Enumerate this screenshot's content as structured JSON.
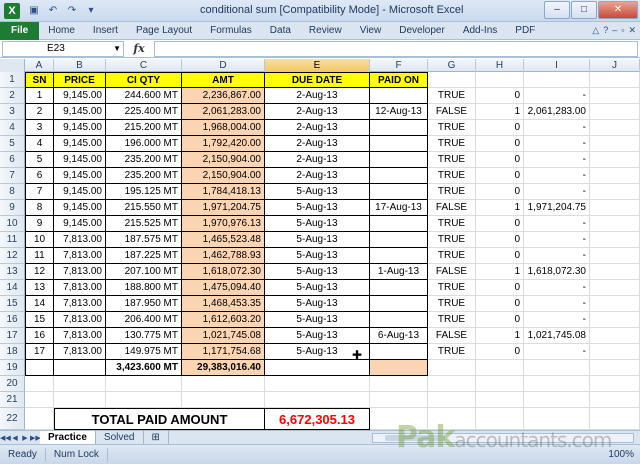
{
  "window": {
    "title": "conditional sum  [Compatibility Mode]  -  Microsoft Excel",
    "app_icon": "X",
    "controls": [
      "–",
      "□",
      "✕"
    ]
  },
  "ribbon": {
    "tabs": [
      "File",
      "Home",
      "Insert",
      "Page Layout",
      "Formulas",
      "Data",
      "Review",
      "View",
      "Developer",
      "Add-Ins",
      "PDF"
    ]
  },
  "formula_bar": {
    "name_box": "E23",
    "fx": "fx",
    "value": ""
  },
  "columns": [
    "A",
    "B",
    "C",
    "D",
    "E",
    "F",
    "G",
    "H",
    "I",
    "J"
  ],
  "header": {
    "row": "1",
    "sn": "SN",
    "price": "PRICE",
    "ci_qty": "CI QTY",
    "amt": "AMT",
    "due_date": "DUE DATE",
    "paid_on": "PAID ON"
  },
  "rows": [
    {
      "r": "2",
      "sn": "1",
      "price": "9,145.00",
      "qty": "244.600 MT",
      "amt": "2,236,867.00",
      "due": "2-Aug-13",
      "paid": "",
      "g": "TRUE",
      "h": "0",
      "i": "-"
    },
    {
      "r": "3",
      "sn": "2",
      "price": "9,145.00",
      "qty": "225.400 MT",
      "amt": "2,061,283.00",
      "due": "2-Aug-13",
      "paid": "12-Aug-13",
      "g": "FALSE",
      "h": "1",
      "i": "2,061,283.00"
    },
    {
      "r": "4",
      "sn": "3",
      "price": "9,145.00",
      "qty": "215.200 MT",
      "amt": "1,968,004.00",
      "due": "2-Aug-13",
      "paid": "",
      "g": "TRUE",
      "h": "0",
      "i": "-"
    },
    {
      "r": "5",
      "sn": "4",
      "price": "9,145.00",
      "qty": "196.000 MT",
      "amt": "1,792,420.00",
      "due": "2-Aug-13",
      "paid": "",
      "g": "TRUE",
      "h": "0",
      "i": "-"
    },
    {
      "r": "6",
      "sn": "5",
      "price": "9,145.00",
      "qty": "235.200 MT",
      "amt": "2,150,904.00",
      "due": "2-Aug-13",
      "paid": "",
      "g": "TRUE",
      "h": "0",
      "i": "-"
    },
    {
      "r": "7",
      "sn": "6",
      "price": "9,145.00",
      "qty": "235.200 MT",
      "amt": "2,150,904.00",
      "due": "2-Aug-13",
      "paid": "",
      "g": "TRUE",
      "h": "0",
      "i": "-"
    },
    {
      "r": "8",
      "sn": "7",
      "price": "9,145.00",
      "qty": "195.125 MT",
      "amt": "1,784,418.13",
      "due": "5-Aug-13",
      "paid": "",
      "g": "TRUE",
      "h": "0",
      "i": "-"
    },
    {
      "r": "9",
      "sn": "8",
      "price": "9,145.00",
      "qty": "215.550 MT",
      "amt": "1,971,204.75",
      "due": "5-Aug-13",
      "paid": "17-Aug-13",
      "g": "FALSE",
      "h": "1",
      "i": "1,971,204.75"
    },
    {
      "r": "10",
      "sn": "9",
      "price": "9,145.00",
      "qty": "215.525 MT",
      "amt": "1,970,976.13",
      "due": "5-Aug-13",
      "paid": "",
      "g": "TRUE",
      "h": "0",
      "i": "-"
    },
    {
      "r": "11",
      "sn": "10",
      "price": "7,813.00",
      "qty": "187.575 MT",
      "amt": "1,465,523.48",
      "due": "5-Aug-13",
      "paid": "",
      "g": "TRUE",
      "h": "0",
      "i": "-"
    },
    {
      "r": "12",
      "sn": "11",
      "price": "7,813.00",
      "qty": "187.225 MT",
      "amt": "1,462,788.93",
      "due": "5-Aug-13",
      "paid": "",
      "g": "TRUE",
      "h": "0",
      "i": "-"
    },
    {
      "r": "13",
      "sn": "12",
      "price": "7,813.00",
      "qty": "207.100 MT",
      "amt": "1,618,072.30",
      "due": "5-Aug-13",
      "paid": "1-Aug-13",
      "g": "FALSE",
      "h": "1",
      "i": "1,618,072.30"
    },
    {
      "r": "14",
      "sn": "13",
      "price": "7,813.00",
      "qty": "188.800 MT",
      "amt": "1,475,094.40",
      "due": "5-Aug-13",
      "paid": "",
      "g": "TRUE",
      "h": "0",
      "i": "-"
    },
    {
      "r": "15",
      "sn": "14",
      "price": "7,813.00",
      "qty": "187.950 MT",
      "amt": "1,468,453.35",
      "due": "5-Aug-13",
      "paid": "",
      "g": "TRUE",
      "h": "0",
      "i": "-"
    },
    {
      "r": "16",
      "sn": "15",
      "price": "7,813.00",
      "qty": "206.400 MT",
      "amt": "1,612,603.20",
      "due": "5-Aug-13",
      "paid": "",
      "g": "TRUE",
      "h": "0",
      "i": "-"
    },
    {
      "r": "17",
      "sn": "16",
      "price": "7,813.00",
      "qty": "130.775 MT",
      "amt": "1,021,745.08",
      "due": "5-Aug-13",
      "paid": "6-Aug-13",
      "g": "FALSE",
      "h": "1",
      "i": "1,021,745.08"
    },
    {
      "r": "18",
      "sn": "17",
      "price": "7,813.00",
      "qty": "149.975 MT",
      "amt": "1,171,754.68",
      "due": "5-Aug-13",
      "paid": "",
      "g": "TRUE",
      "h": "0",
      "i": "-"
    }
  ],
  "totals": {
    "row": "19",
    "qty_total": "3,423.600 MT",
    "amt_total": "29,383,016.40"
  },
  "empty_rows": [
    "20",
    "21"
  ],
  "summary": {
    "row": "22",
    "label": "TOTAL PAID AMOUNT",
    "value": "6,672,305.13"
  },
  "active_row": "23",
  "sheets": [
    "Practice",
    "Solved"
  ],
  "status": {
    "ready": "Ready",
    "num_lock": "Num Lock",
    "zoom": "100%"
  },
  "watermark": {
    "brand": "Pak",
    "suffix": "accountants.com"
  },
  "colors": {
    "amt_fill": "#fbd4b4",
    "header_fill": "#ffff00",
    "total_paid": "#ff0000",
    "file_tab": "#1e7b34"
  }
}
